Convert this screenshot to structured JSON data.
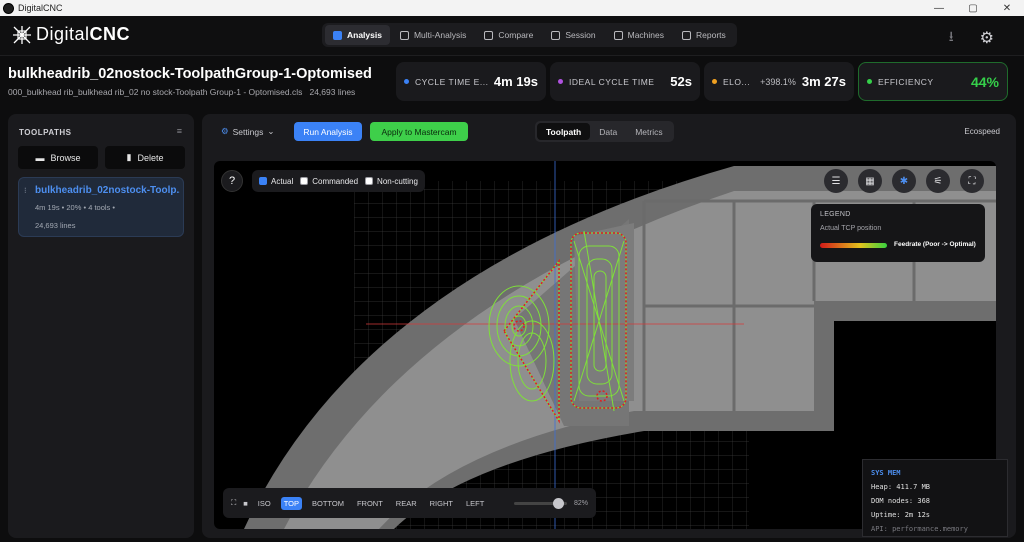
{
  "window": {
    "title": "DigitalCNC",
    "controls": [
      "—",
      "▢",
      "✕"
    ]
  },
  "brand": {
    "prefix": "Digital",
    "suffix": "CNC"
  },
  "nav": [
    {
      "label": "Analysis",
      "icon": "analysis-icon",
      "active": true
    },
    {
      "label": "Multi-Analysis",
      "icon": "multi-analysis-icon",
      "active": false
    },
    {
      "label": "Compare",
      "icon": "compare-icon",
      "active": false
    },
    {
      "label": "Session",
      "icon": "session-icon",
      "active": false
    },
    {
      "label": "Machines",
      "icon": "machines-icon",
      "active": false
    },
    {
      "label": "Reports",
      "icon": "reports-icon",
      "active": false
    }
  ],
  "project": {
    "title": "bulkheadrib_02nostock-ToolpathGroup-1-Optomised",
    "file": "000_bulkhead rib_bulkhead rib_02 no stock-Toolpath Group-1 - Optomised.cls",
    "lines": "24,693 lines"
  },
  "metrics": {
    "cycle": {
      "label": "CYCLE TIME E...",
      "value": "4m 19s",
      "color": "#3b82f6"
    },
    "ideal": {
      "label": "IDEAL CYCLE TIME",
      "value": "52s",
      "color": "#b052e0"
    },
    "elo": {
      "label": "ELO...",
      "delta": "+398.1%",
      "value": "3m 27s",
      "color": "#f0a020"
    },
    "efficiency": {
      "label": "EFFICIENCY",
      "value": "44%",
      "color": "#35d04a"
    }
  },
  "sidebar": {
    "heading": "TOOLPATHS",
    "browse_label": "Browse",
    "delete_label": "Delete",
    "item": {
      "title": "bulkheadrib_02nostock-Toolp...",
      "meta": "4m 19s  •  20%  •  4 tools  •",
      "lines": "24,693 lines"
    }
  },
  "toolbar": {
    "settings_label": "Settings",
    "run_label": "Run Analysis",
    "apply_label": "Apply to Mastercam",
    "tabs": [
      {
        "label": "Toolpath",
        "active": true
      },
      {
        "label": "Data",
        "active": false
      },
      {
        "label": "Metrics",
        "active": false
      }
    ],
    "profile": "Ecospeed"
  },
  "viewport": {
    "filters": [
      {
        "label": "Actual",
        "checked": true
      },
      {
        "label": "Commanded",
        "checked": false
      },
      {
        "label": "Non-cutting",
        "checked": false
      }
    ],
    "legend": {
      "title": "LEGEND",
      "subtitle": "Actual TCP position",
      "scale_label": "Feedrate (Poor -> Optimal)"
    },
    "views": [
      "ISO",
      "TOP",
      "BOTTOM",
      "FRONT",
      "REAR",
      "RIGHT",
      "LEFT"
    ],
    "active_view": "TOP",
    "zoom": "82%",
    "zoom_fraction": 0.82
  },
  "sysmem": {
    "title": "SYS MEM",
    "heap": "Heap: 411.7 MB",
    "dom": "DOM nodes: 368",
    "uptime": "Uptime: 2m 12s",
    "api": "API: performance.memory"
  }
}
